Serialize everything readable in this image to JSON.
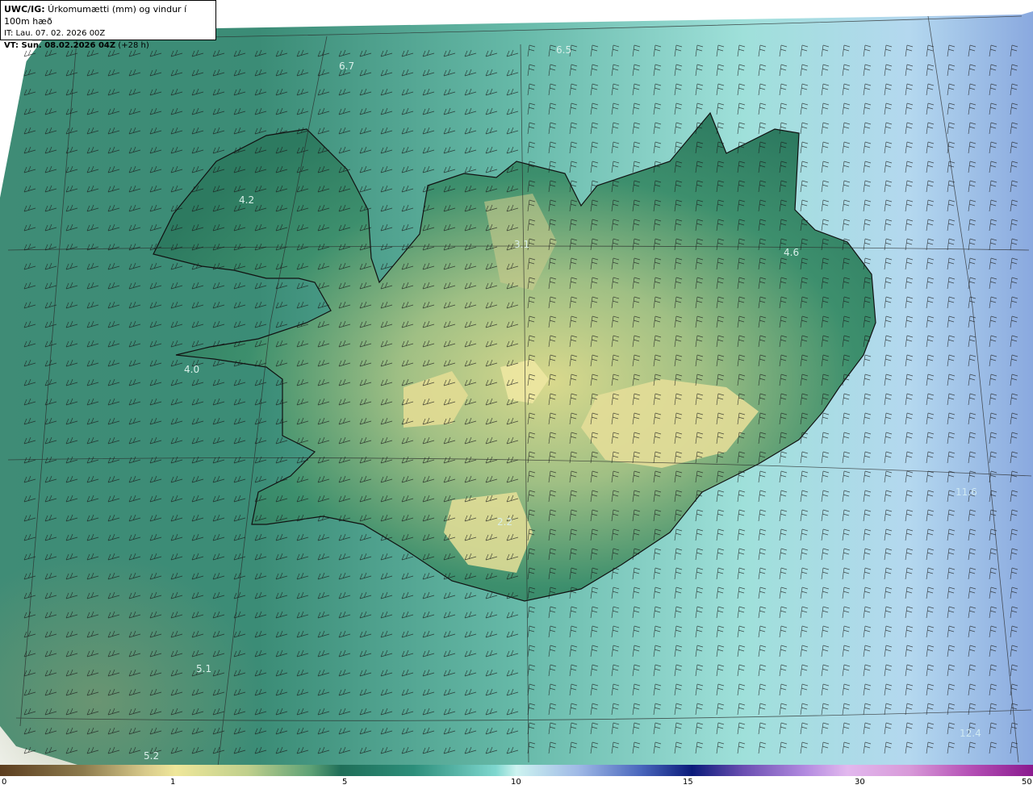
{
  "header": {
    "title_bold": "UWC/IG:",
    "title_rest": " Úrkomumætti (mm) og vindur í 100m hæð",
    "it_line": "IT: Lau. 07. 02. 2026 00Z",
    "vt_bold": "VT: Sun. 08.02.2026 04Z",
    "vt_rest": " (+28 h)"
  },
  "labels": [
    "6.7",
    "6.5",
    "4.2",
    "3.1",
    "4.6",
    "4.0",
    "2.2",
    "11.6",
    "5.1",
    "12.4",
    "5.2"
  ],
  "colorbar": {
    "ticks": [
      "0",
      "1",
      "5",
      "10",
      "15",
      "30",
      "50"
    ]
  },
  "icons": {
    "wind": "wind-barb-icon"
  },
  "colors": {
    "sea_dark": "#2f7f6a",
    "sea_light": "#a8e6e0",
    "land_high": "#e6e19a",
    "coast": "#111111"
  }
}
